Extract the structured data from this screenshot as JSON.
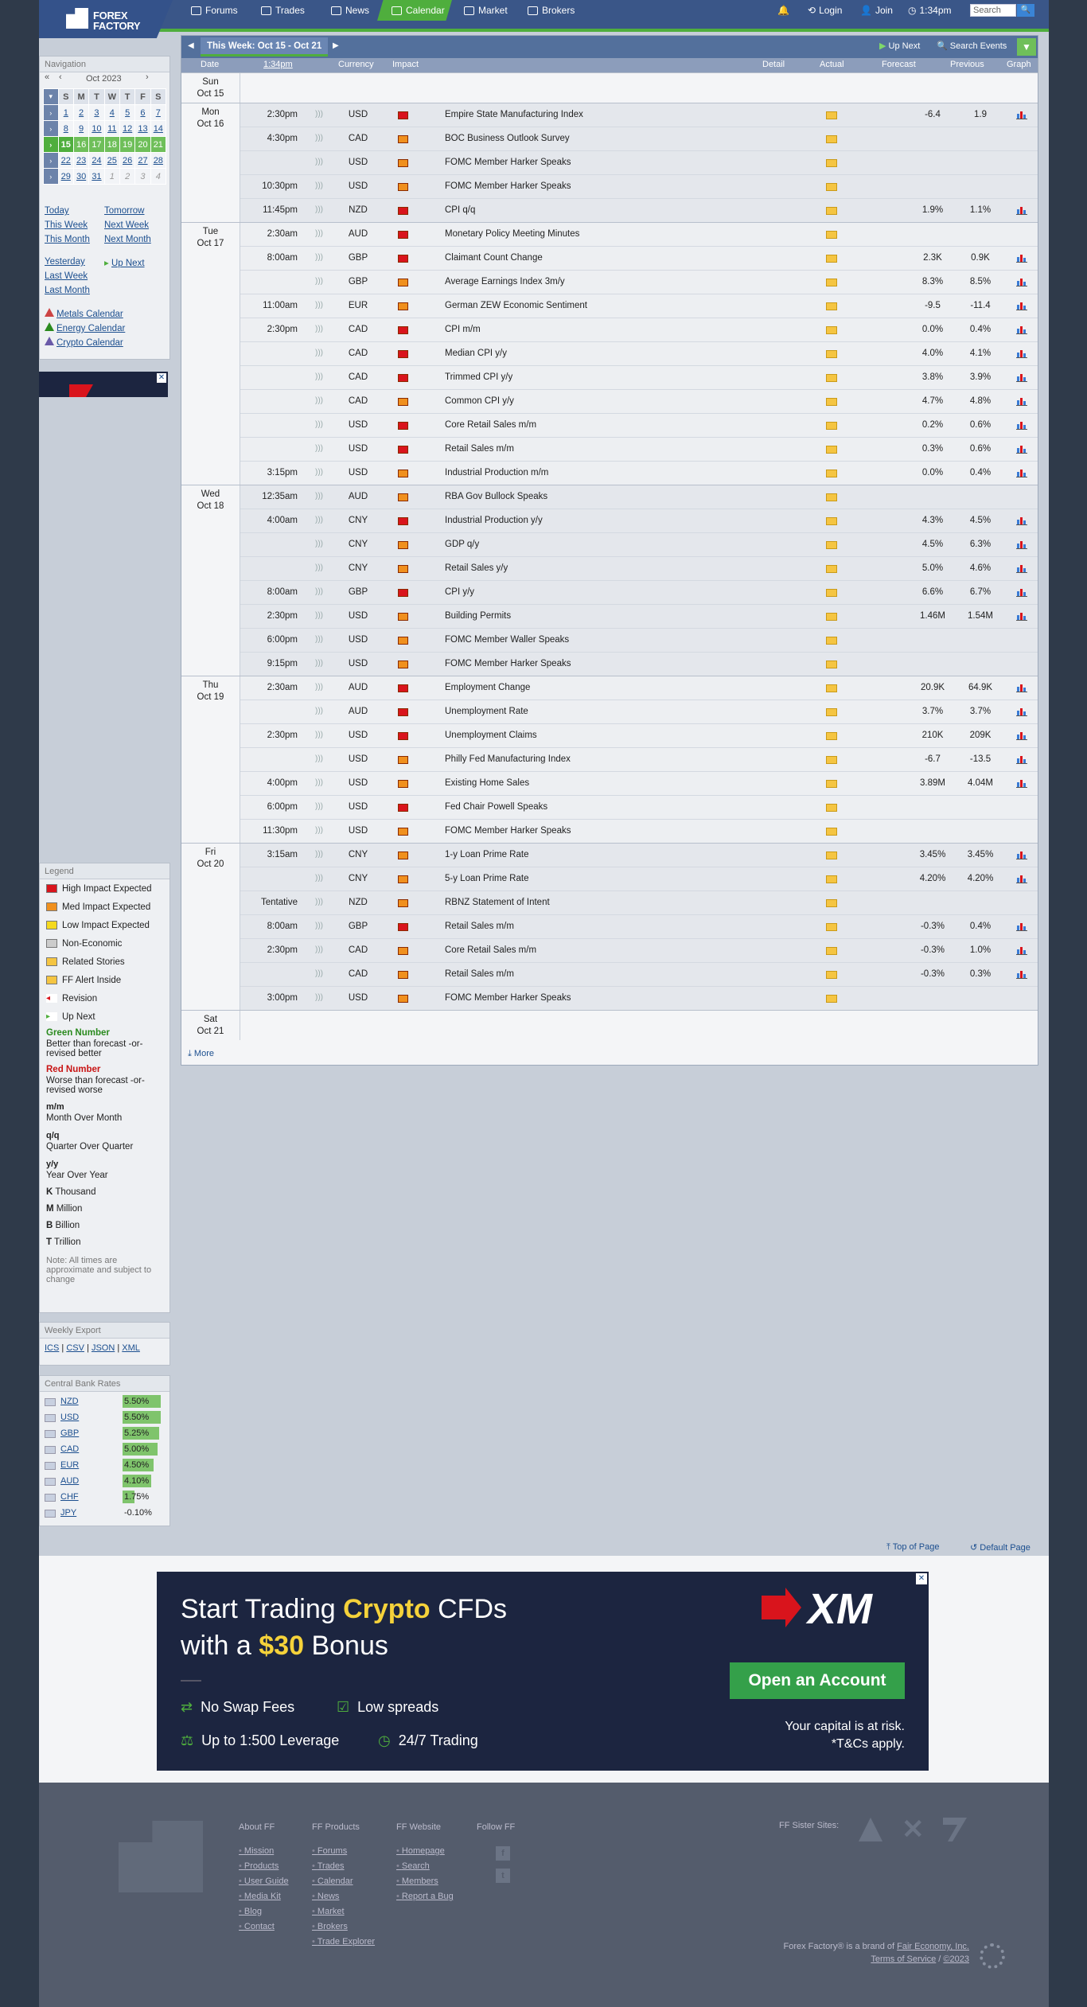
{
  "header": {
    "logo_line1": "FOREX",
    "logo_line2": "FACTORY",
    "nav": [
      "Forums",
      "Trades",
      "News",
      "Calendar",
      "Market",
      "Brokers"
    ],
    "login": "Login",
    "join": "Join",
    "time": "1:34pm",
    "search_placeholder": "Search"
  },
  "sidebar": {
    "nav_title": "Navigation",
    "month": "Oct 2023",
    "dow": [
      "S",
      "M",
      "T",
      "W",
      "T",
      "F",
      "S"
    ],
    "weeks": [
      [
        "1",
        "2",
        "3",
        "4",
        "5",
        "6",
        "7"
      ],
      [
        "8",
        "9",
        "10",
        "11",
        "12",
        "13",
        "14"
      ],
      [
        "15",
        "16",
        "17",
        "18",
        "19",
        "20",
        "21"
      ],
      [
        "22",
        "23",
        "24",
        "25",
        "26",
        "27",
        "28"
      ],
      [
        "29",
        "30",
        "31",
        "1",
        "2",
        "3",
        "4"
      ]
    ],
    "links_left": [
      "Today",
      "This Week",
      "This Month"
    ],
    "links_right": [
      "Tomorrow",
      "Next Week",
      "Next Month"
    ],
    "links2_left": [
      "Yesterday",
      "Last Week",
      "Last Month"
    ],
    "up_next": "Up Next",
    "calendars": [
      "Metals Calendar",
      "Energy Calendar",
      "Crypto Calendar"
    ],
    "legend_title": "Legend",
    "legend": [
      "High Impact Expected",
      "Med Impact Expected",
      "Low Impact Expected",
      "Non-Economic",
      "Related Stories",
      "FF Alert Inside",
      "Revision",
      "Up Next"
    ],
    "green_number": "Green Number",
    "green_desc": "Better than forecast -or- revised better",
    "red_number": "Red Number",
    "red_desc": "Worse than forecast -or- revised worse",
    "abbr": [
      {
        "k": "m/m",
        "v": "Month Over Month"
      },
      {
        "k": "q/q",
        "v": "Quarter Over Quarter"
      },
      {
        "k": "y/y",
        "v": "Year Over Year"
      }
    ],
    "units": [
      {
        "k": "K",
        "v": "Thousand"
      },
      {
        "k": "M",
        "v": "Million"
      },
      {
        "k": "B",
        "v": "Billion"
      },
      {
        "k": "T",
        "v": "Trillion"
      }
    ],
    "note": "Note: All times are approximate and subject to change",
    "export_title": "Weekly Export",
    "export": [
      "ICS",
      "CSV",
      "JSON",
      "XML"
    ],
    "cb_title": "Central Bank Rates",
    "cb": [
      {
        "c": "NZD",
        "r": "5.50%"
      },
      {
        "c": "USD",
        "r": "5.50%"
      },
      {
        "c": "GBP",
        "r": "5.25%"
      },
      {
        "c": "CAD",
        "r": "5.00%"
      },
      {
        "c": "EUR",
        "r": "4.50%"
      },
      {
        "c": "AUD",
        "r": "4.10%"
      },
      {
        "c": "CHF",
        "r": "1.75%"
      },
      {
        "c": "JPY",
        "r": "-0.10%"
      }
    ]
  },
  "calendar": {
    "week_label": "This Week: Oct 15 - Oct 21",
    "up_next": "Up Next",
    "search_events": "Search Events",
    "columns": {
      "date": "Date",
      "time": "1:34pm",
      "currency": "Currency",
      "impact": "Impact",
      "detail": "Detail",
      "actual": "Actual",
      "forecast": "Forecast",
      "previous": "Previous",
      "graph": "Graph"
    },
    "more": "More",
    "days": [
      {
        "d1": "Sun",
        "d2": "Oct 15",
        "rows": []
      },
      {
        "d1": "Mon",
        "d2": "Oct 16",
        "rows": [
          [
            "2:30pm",
            "USD",
            "h",
            "Empire State Manufacturing Index",
            "-6.4",
            "1.9",
            1
          ],
          [
            "4:30pm",
            "CAD",
            "m",
            "BOC Business Outlook Survey",
            "",
            "",
            0
          ],
          [
            "",
            "USD",
            "m",
            "FOMC Member Harker Speaks",
            "",
            "",
            0
          ],
          [
            "10:30pm",
            "USD",
            "m",
            "FOMC Member Harker Speaks",
            "",
            "",
            0
          ],
          [
            "11:45pm",
            "NZD",
            "h",
            "CPI q/q",
            "1.9%",
            "1.1%",
            1
          ]
        ]
      },
      {
        "d1": "Tue",
        "d2": "Oct 17",
        "rows": [
          [
            "2:30am",
            "AUD",
            "h",
            "Monetary Policy Meeting Minutes",
            "",
            "",
            0
          ],
          [
            "8:00am",
            "GBP",
            "h",
            "Claimant Count Change",
            "2.3K",
            "0.9K",
            1
          ],
          [
            "",
            "GBP",
            "m",
            "Average Earnings Index 3m/y",
            "8.3%",
            "8.5%",
            1
          ],
          [
            "11:00am",
            "EUR",
            "m",
            "German ZEW Economic Sentiment",
            "-9.5",
            "-11.4",
            1
          ],
          [
            "2:30pm",
            "CAD",
            "h",
            "CPI m/m",
            "0.0%",
            "0.4%",
            1
          ],
          [
            "",
            "CAD",
            "h",
            "Median CPI y/y",
            "4.0%",
            "4.1%",
            1
          ],
          [
            "",
            "CAD",
            "h",
            "Trimmed CPI y/y",
            "3.8%",
            "3.9%",
            1
          ],
          [
            "",
            "CAD",
            "m",
            "Common CPI y/y",
            "4.7%",
            "4.8%",
            1
          ],
          [
            "",
            "USD",
            "h",
            "Core Retail Sales m/m",
            "0.2%",
            "0.6%",
            1
          ],
          [
            "",
            "USD",
            "h",
            "Retail Sales m/m",
            "0.3%",
            "0.6%",
            1
          ],
          [
            "3:15pm",
            "USD",
            "m",
            "Industrial Production m/m",
            "0.0%",
            "0.4%",
            1
          ]
        ]
      },
      {
        "d1": "Wed",
        "d2": "Oct 18",
        "rows": [
          [
            "12:35am",
            "AUD",
            "m",
            "RBA Gov Bullock Speaks",
            "",
            "",
            0
          ],
          [
            "4:00am",
            "CNY",
            "h",
            "Industrial Production y/y",
            "4.3%",
            "4.5%",
            1
          ],
          [
            "",
            "CNY",
            "m",
            "GDP q/y",
            "4.5%",
            "6.3%",
            1
          ],
          [
            "",
            "CNY",
            "m",
            "Retail Sales y/y",
            "5.0%",
            "4.6%",
            1
          ],
          [
            "8:00am",
            "GBP",
            "h",
            "CPI y/y",
            "6.6%",
            "6.7%",
            1
          ],
          [
            "2:30pm",
            "USD",
            "m",
            "Building Permits",
            "1.46M",
            "1.54M",
            1
          ],
          [
            "6:00pm",
            "USD",
            "m",
            "FOMC Member Waller Speaks",
            "",
            "",
            0
          ],
          [
            "9:15pm",
            "USD",
            "m",
            "FOMC Member Harker Speaks",
            "",
            "",
            0
          ]
        ]
      },
      {
        "d1": "Thu",
        "d2": "Oct 19",
        "rows": [
          [
            "2:30am",
            "AUD",
            "h",
            "Employment Change",
            "20.9K",
            "64.9K",
            1
          ],
          [
            "",
            "AUD",
            "h",
            "Unemployment Rate",
            "3.7%",
            "3.7%",
            1
          ],
          [
            "2:30pm",
            "USD",
            "h",
            "Unemployment Claims",
            "210K",
            "209K",
            1
          ],
          [
            "",
            "USD",
            "m",
            "Philly Fed Manufacturing Index",
            "-6.7",
            "-13.5",
            1
          ],
          [
            "4:00pm",
            "USD",
            "m",
            "Existing Home Sales",
            "3.89M",
            "4.04M",
            1
          ],
          [
            "6:00pm",
            "USD",
            "h",
            "Fed Chair Powell Speaks",
            "",
            "",
            0
          ],
          [
            "11:30pm",
            "USD",
            "m",
            "FOMC Member Harker Speaks",
            "",
            "",
            0
          ]
        ]
      },
      {
        "d1": "Fri",
        "d2": "Oct 20",
        "rows": [
          [
            "3:15am",
            "CNY",
            "m",
            "1-y Loan Prime Rate",
            "3.45%",
            "3.45%",
            1
          ],
          [
            "",
            "CNY",
            "m",
            "5-y Loan Prime Rate",
            "4.20%",
            "4.20%",
            1
          ],
          [
            "Tentative",
            "NZD",
            "m",
            "RBNZ Statement of Intent",
            "",
            "",
            0
          ],
          [
            "8:00am",
            "GBP",
            "h",
            "Retail Sales m/m",
            "-0.3%",
            "0.4%",
            1
          ],
          [
            "2:30pm",
            "CAD",
            "m",
            "Core Retail Sales m/m",
            "-0.3%",
            "1.0%",
            1
          ],
          [
            "",
            "CAD",
            "m",
            "Retail Sales m/m",
            "-0.3%",
            "0.3%",
            1
          ],
          [
            "3:00pm",
            "USD",
            "m",
            "FOMC Member Harker Speaks",
            "",
            "",
            0
          ]
        ]
      },
      {
        "d1": "Sat",
        "d2": "Oct 21",
        "rows": []
      }
    ]
  },
  "footer_links": {
    "top": "Top of Page",
    "default": "Default Page"
  },
  "ad": {
    "l1a": "Start Trading ",
    "l1b": "Crypto",
    "l1c": " CFDs",
    "l2a": "with a ",
    "l2b": "$30",
    "l2c": " Bonus",
    "f1": "No Swap Fees",
    "f2": "Low spreads",
    "f3": "Up to 1:500 Leverage",
    "f4": "24/7 Trading",
    "brand": "XM",
    "cta": "Open an Account",
    "risk1": "Your capital is at risk.",
    "risk2": "*T&Cs apply."
  },
  "footer": {
    "about": "About FF",
    "about_links": [
      "Mission",
      "Products",
      "User Guide",
      "Media Kit",
      "Blog",
      "Contact"
    ],
    "products": "FF Products",
    "products_links": [
      "Forums",
      "Trades",
      "Calendar",
      "News",
      "Market",
      "Brokers",
      "Trade Explorer"
    ],
    "website": "FF Website",
    "website_links": [
      "Homepage",
      "Search",
      "Members",
      "Report a Bug"
    ],
    "follow": "Follow FF",
    "sister": "FF Sister Sites:",
    "brand_line": "Forex Factory® is a brand of",
    "brand_link": "Fair Economy, Inc.",
    "terms": "Terms of Service",
    "copy": "©2023"
  },
  "colors": {
    "high": "#d9141c",
    "med": "#f0901e",
    "low": "#f5d91e",
    "green": "#4fae3d"
  }
}
